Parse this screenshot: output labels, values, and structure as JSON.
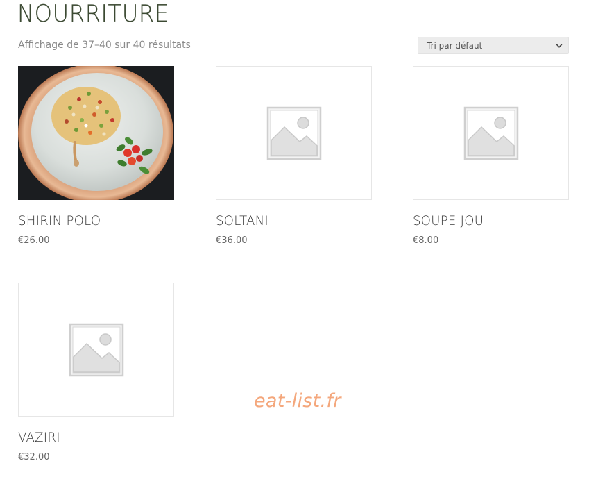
{
  "header": {
    "title": "NOURRITURE",
    "result_count": "Affichage de 37–40 sur 40 résultats"
  },
  "sort": {
    "selected": "Tri par défaut",
    "icon": "chevron-down-icon"
  },
  "products": [
    {
      "name": "SHIRIN POLO",
      "price": "€26.00",
      "image": "food-photo"
    },
    {
      "name": "SOLTANI",
      "price": "€36.00",
      "image": "placeholder-image-icon"
    },
    {
      "name": "SOUPE JOU",
      "price": "€8.00",
      "image": "placeholder-image-icon"
    },
    {
      "name": "VAZIRI",
      "price": "€32.00",
      "image": "placeholder-image-icon"
    }
  ],
  "watermark": {
    "text": "eat-list.fr",
    "color": "#f4a77c"
  },
  "colors": {
    "title": "#3c4a33",
    "placeholder_gray": "#d9d9d9"
  }
}
